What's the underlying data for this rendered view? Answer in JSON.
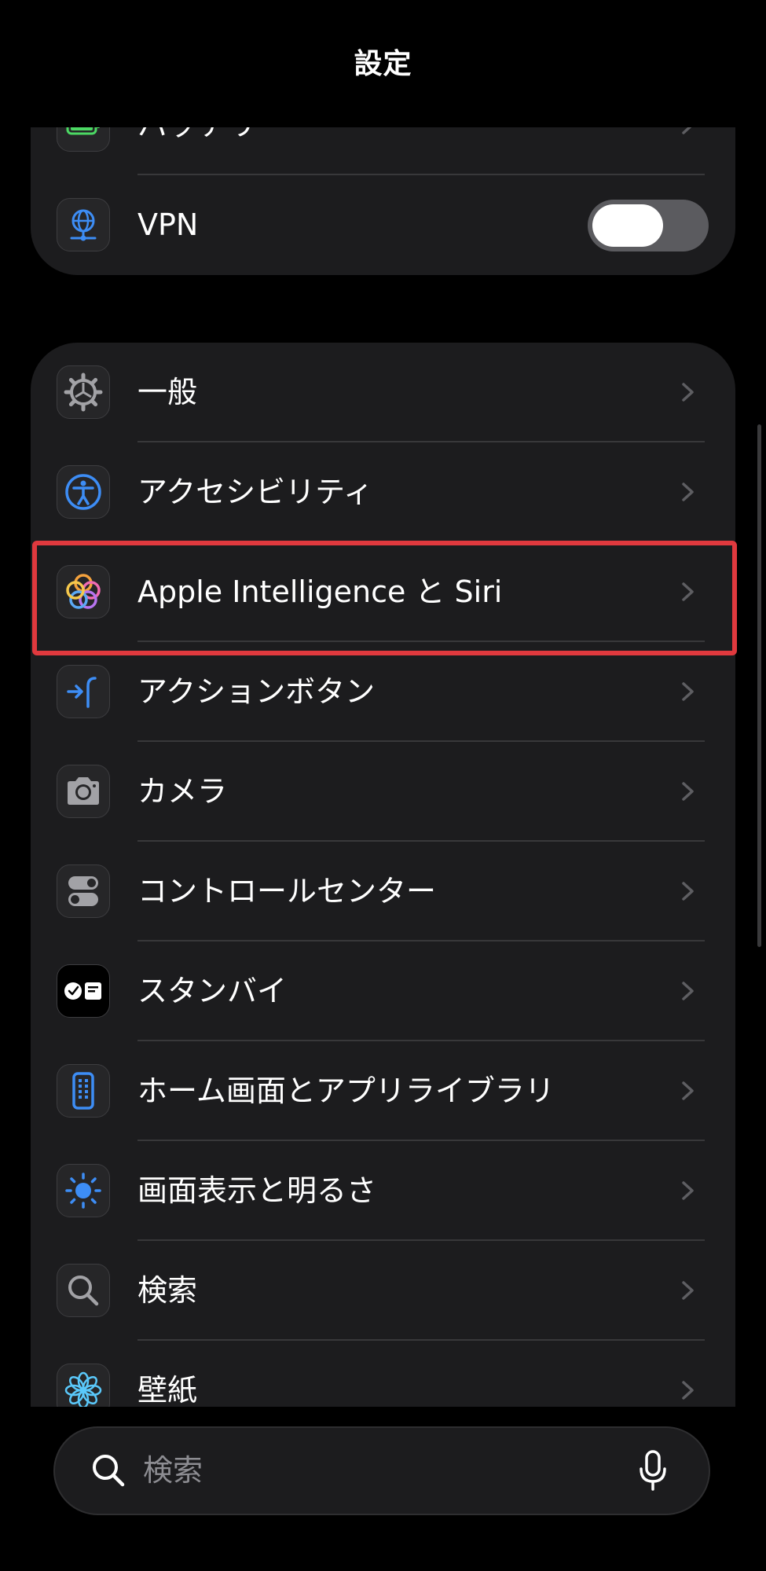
{
  "header": {
    "title": "設定"
  },
  "group1": {
    "battery_label": "バッテリー",
    "vpn_label": "VPN",
    "vpn_toggle_on": false
  },
  "group2": {
    "items": [
      {
        "label": "一般",
        "icon": "gear-icon"
      },
      {
        "label": "アクセシビリティ",
        "icon": "accessibility-icon"
      },
      {
        "label": "Apple Intelligence と Siri",
        "icon": "apple-intelligence-icon"
      },
      {
        "label": "アクションボタン",
        "icon": "action-button-icon"
      },
      {
        "label": "カメラ",
        "icon": "camera-icon"
      },
      {
        "label": "コントロールセンター",
        "icon": "control-center-icon"
      },
      {
        "label": "スタンバイ",
        "icon": "standby-icon"
      },
      {
        "label": "ホーム画面とアプリライブラリ",
        "icon": "home-screen-icon"
      },
      {
        "label": "画面表示と明るさ",
        "icon": "brightness-icon"
      },
      {
        "label": "検索",
        "icon": "search-icon"
      },
      {
        "label": "壁紙",
        "icon": "wallpaper-icon"
      }
    ]
  },
  "search": {
    "placeholder": "検索"
  },
  "colors": {
    "highlight": "#e0393e",
    "accent_blue": "#3d8df5",
    "cell_bg": "#1c1c1e"
  }
}
